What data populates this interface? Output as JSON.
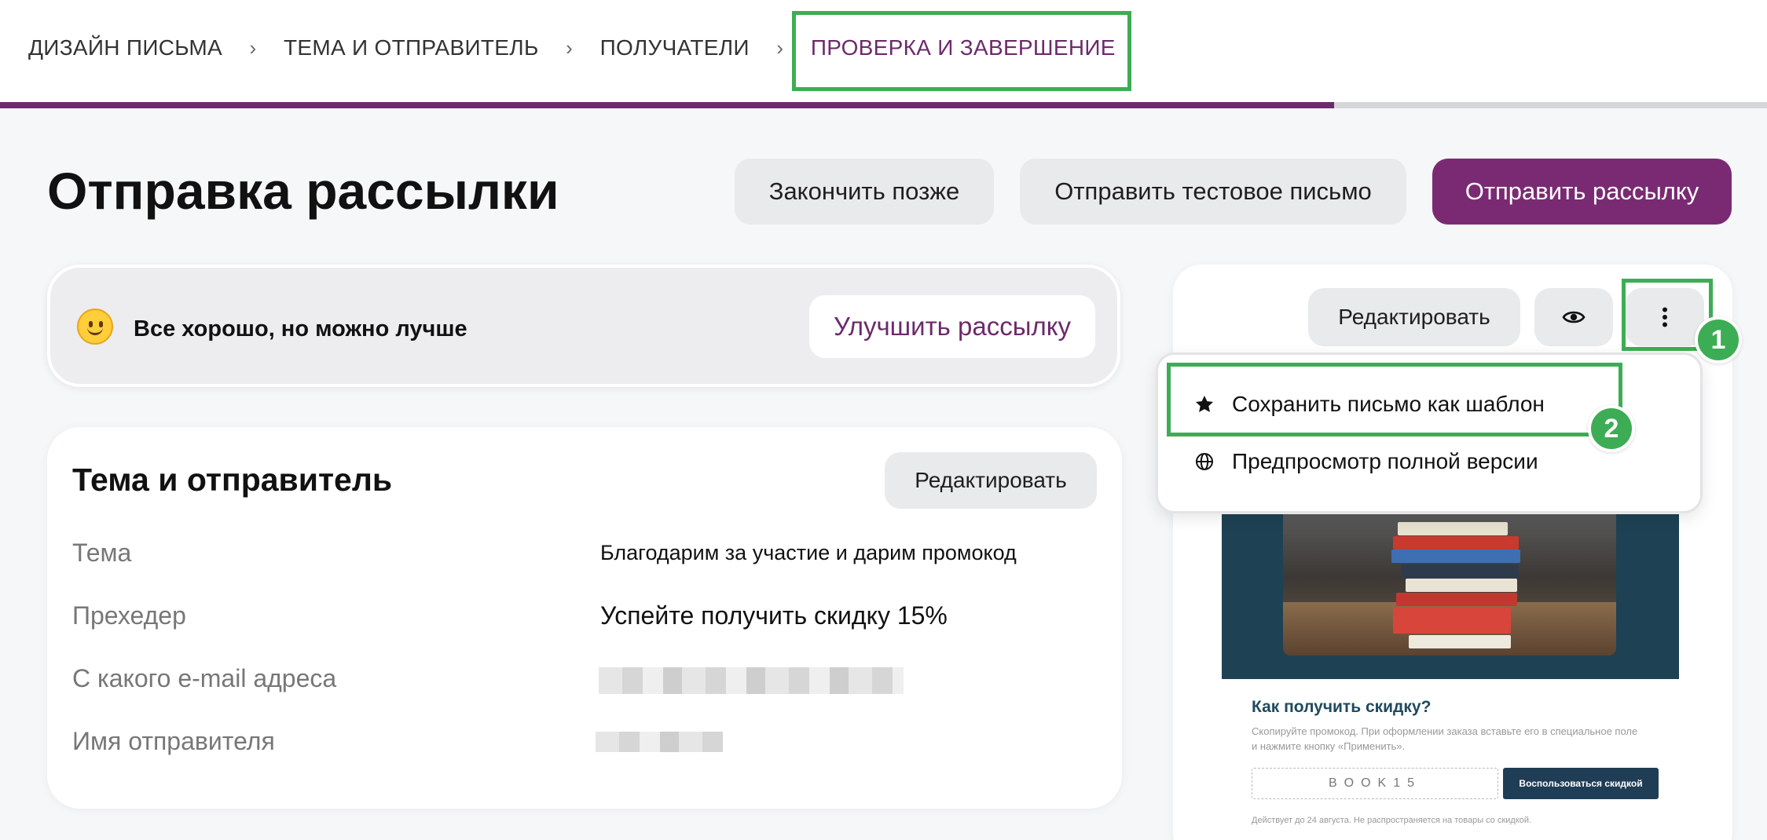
{
  "stepper": {
    "steps": [
      {
        "label": "ДИЗАЙН ПИСЬМА",
        "active": false
      },
      {
        "label": "ТЕМА И ОТПРАВИТЕЛЬ",
        "active": false
      },
      {
        "label": "ПОЛУЧАТЕЛИ",
        "active": false
      },
      {
        "label": "ПРОВЕРКА И ЗАВЕРШЕНИЕ",
        "active": true
      }
    ],
    "separator": "›",
    "progress_fraction": 0.755
  },
  "header": {
    "title": "Отправка рассылки",
    "finish_later_label": "Закончить позже",
    "send_test_label": "Отправить тестовое письмо",
    "send_label": "Отправить рассылку"
  },
  "quality": {
    "icon": "slightly-smiling-face-icon",
    "text": "Все хорошо, но можно лучше",
    "improve_label": "Улучшить рассылку"
  },
  "sender_card": {
    "title": "Тема и отправитель",
    "edit_label": "Редактировать",
    "rows": [
      {
        "label": "Тема",
        "value": "Благодарим за участие и дарим промокод"
      },
      {
        "label": "Прехедер",
        "value": "Успейте получить скидку 15%"
      },
      {
        "label": "С какого e-mail адреса",
        "value": ""
      },
      {
        "label": "Имя отправителя",
        "value": ""
      }
    ]
  },
  "preview": {
    "edit_label": "Редактировать",
    "view_icon": "eye-icon",
    "more_icon": "more-vertical-icon",
    "menu": [
      {
        "icon": "star-icon",
        "label": "Сохранить письмо как шаблон"
      },
      {
        "icon": "globe-icon",
        "label": "Предпросмотр полной версии"
      }
    ],
    "email": {
      "promo_title": "Как получить скидку?",
      "promo_text": "Скопируйте промокод. При оформлении заказа вставьте его в специальное поле и нажмите кнопку «Применить».",
      "promo_code": "BOOK15",
      "promo_button": "Воспользоваться скидкой",
      "footnote": "Действует до 24 августа. Не распространяется на товары со скидкой."
    }
  },
  "annotations": {
    "badge_1": "1",
    "badge_2": "2"
  },
  "colors": {
    "brand": "#7a2a73",
    "brand_text": "#6d2a6b",
    "highlight": "#3dad55",
    "email_dark": "#1f3e56"
  }
}
